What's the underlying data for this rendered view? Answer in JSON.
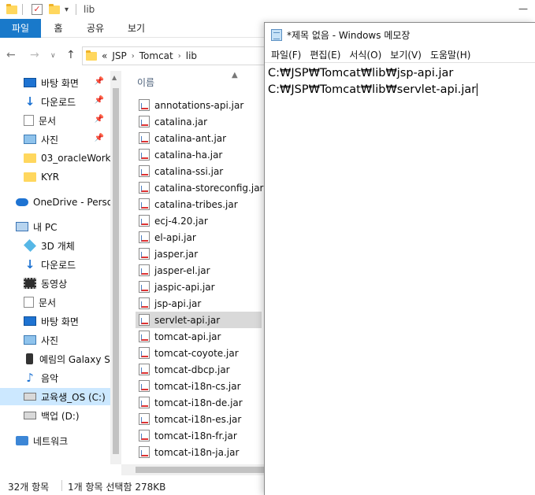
{
  "explorer": {
    "path_field": "lib",
    "ribbon_tabs": [
      "파일",
      "홈",
      "공유",
      "보기"
    ],
    "breadcrumb": {
      "overflow": "«",
      "items": [
        "JSP",
        "Tomcat",
        "lib"
      ]
    },
    "nav_pane": [
      {
        "label": "바탕 화면",
        "icon": "desktop-icon",
        "pinned": true
      },
      {
        "label": "다운로드",
        "icon": "download-icon",
        "pinned": true
      },
      {
        "label": "문서",
        "icon": "document-icon",
        "pinned": true
      },
      {
        "label": "사진",
        "icon": "pictures-icon",
        "pinned": true
      },
      {
        "label": "03_oracleWork",
        "icon": "folder-icon",
        "pinned": false
      },
      {
        "label": "KYR",
        "icon": "folder-icon",
        "pinned": false
      },
      {
        "label": "OneDrive - Person",
        "icon": "onedrive-icon",
        "pinned": false
      },
      {
        "label": "내 PC",
        "icon": "pc-icon",
        "pinned": false
      },
      {
        "label": "3D 개체",
        "icon": "3d-objects-icon",
        "pinned": false
      },
      {
        "label": "다운로드",
        "icon": "download-icon",
        "pinned": false
      },
      {
        "label": "동영상",
        "icon": "video-icon",
        "pinned": false
      },
      {
        "label": "문서",
        "icon": "document-icon",
        "pinned": false
      },
      {
        "label": "바탕 화면",
        "icon": "desktop-icon",
        "pinned": false
      },
      {
        "label": "사진",
        "icon": "pictures-icon",
        "pinned": false
      },
      {
        "label": "예림의 Galaxy S",
        "icon": "phone-icon",
        "pinned": false
      },
      {
        "label": "음악",
        "icon": "music-icon",
        "pinned": false
      },
      {
        "label": "교육생_OS (C:)",
        "icon": "drive-c-icon",
        "pinned": false,
        "selected": true
      },
      {
        "label": "백업 (D:)",
        "icon": "drive-d-icon",
        "pinned": false
      },
      {
        "label": "네트워크",
        "icon": "network-icon",
        "pinned": false
      }
    ],
    "column_header": "이름",
    "files": [
      "annotations-api.jar",
      "catalina.jar",
      "catalina-ant.jar",
      "catalina-ha.jar",
      "catalina-ssi.jar",
      "catalina-storeconfig.jar",
      "catalina-tribes.jar",
      "ecj-4.20.jar",
      "el-api.jar",
      "jasper.jar",
      "jasper-el.jar",
      "jaspic-api.jar",
      "jsp-api.jar",
      "servlet-api.jar",
      "tomcat-api.jar",
      "tomcat-coyote.jar",
      "tomcat-dbcp.jar",
      "tomcat-i18n-cs.jar",
      "tomcat-i18n-de.jar",
      "tomcat-i18n-es.jar",
      "tomcat-i18n-fr.jar",
      "tomcat-i18n-ja.jar"
    ],
    "selected_file": "servlet-api.jar",
    "status": {
      "count": "32개 항목",
      "selection": "1개 항목 선택함 278KB"
    }
  },
  "notepad": {
    "title": "*제목 없음 - Windows 메모장",
    "menu": [
      "파일(F)",
      "편집(E)",
      "서식(O)",
      "보기(V)",
      "도움말(H)"
    ],
    "lines": [
      "C:₩JSP₩Tomcat₩lib₩jsp-api.jar",
      "C:₩JSP₩Tomcat₩lib₩servlet-api.jar"
    ]
  },
  "colors": {
    "file_tab": "#1979ca",
    "selected_row": "#d9d9d9",
    "selected_nav": "#cce8ff"
  }
}
